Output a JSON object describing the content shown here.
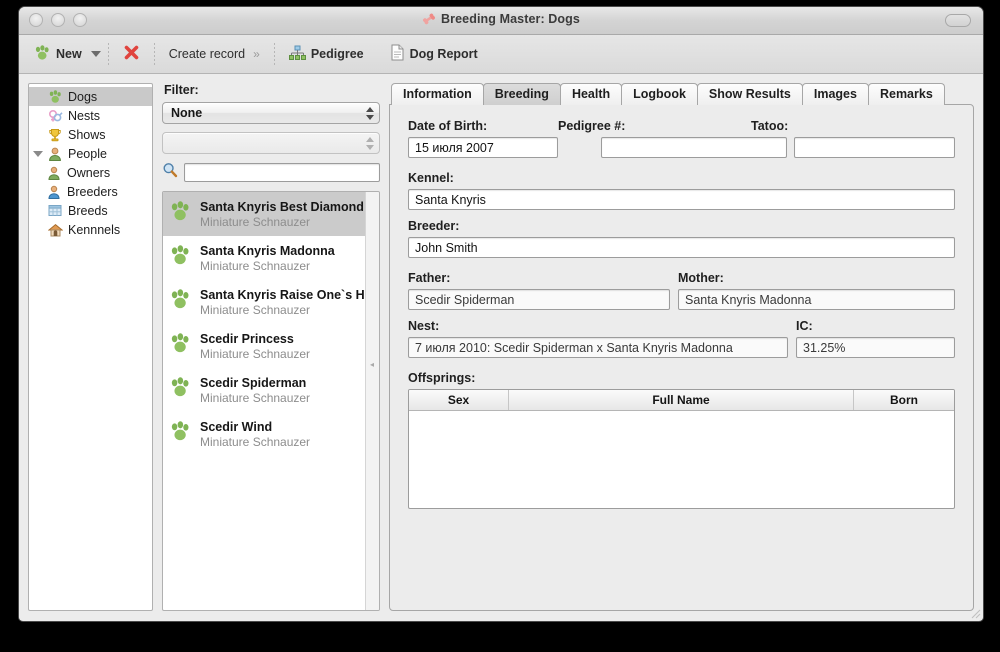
{
  "window": {
    "title": "Breeding Master: Dogs",
    "title_icon": "bone-icon",
    "controls": [
      "close-button",
      "minimize-button",
      "zoom-button"
    ],
    "toolbar_toggle": "toolbar-toggle-button"
  },
  "toolbar": {
    "items": [
      {
        "label": "New",
        "icon": "paw-icon",
        "has_dropdown": true
      },
      {
        "label": "",
        "icon": "delete-x-icon",
        "has_dropdown": false
      },
      {
        "label": "Create record",
        "icon": "",
        "has_dropdown": false,
        "suffix": "»"
      },
      {
        "label": "Pedigree",
        "icon": "pedigree-tree-icon",
        "has_dropdown": false
      },
      {
        "label": "Dog Report",
        "icon": "document-icon",
        "has_dropdown": false
      }
    ]
  },
  "sidebar": {
    "items": [
      {
        "label": "Dogs",
        "icon": "paw-icon",
        "selected": true,
        "indent": false,
        "twisty": ""
      },
      {
        "label": "Nests",
        "icon": "gender-symbols-icon",
        "selected": false,
        "indent": false,
        "twisty": ""
      },
      {
        "label": "Shows",
        "icon": "trophy-icon",
        "selected": false,
        "indent": false,
        "twisty": ""
      },
      {
        "label": "People",
        "icon": "person-icon",
        "selected": false,
        "indent": false,
        "twisty": "expanded"
      },
      {
        "label": "Owners",
        "icon": "person-green-icon",
        "selected": false,
        "indent": true,
        "twisty": ""
      },
      {
        "label": "Breeders",
        "icon": "person-blue-icon",
        "selected": false,
        "indent": true,
        "twisty": ""
      },
      {
        "label": "Breeds",
        "icon": "table-icon",
        "selected": false,
        "indent": false,
        "twisty": ""
      },
      {
        "label": "Kennnels",
        "icon": "house-icon",
        "selected": false,
        "indent": false,
        "twisty": ""
      }
    ]
  },
  "filter": {
    "label": "Filter:",
    "primary_value": "None",
    "secondary_value": "",
    "search_value": "",
    "search_icon": "magnifier-icon"
  },
  "dog_list": [
    {
      "name": "Santa Knyris Best Diamond",
      "breed": "Miniature Schnauzer",
      "selected": true
    },
    {
      "name": "Santa Knyris Madonna",
      "breed": "Miniature Schnauzer",
      "selected": false
    },
    {
      "name": "Santa Knyris Raise One`s Ho",
      "breed": "Miniature Schnauzer",
      "selected": false
    },
    {
      "name": "Scedir Princess",
      "breed": "Miniature Schnauzer",
      "selected": false
    },
    {
      "name": "Scedir Spiderman",
      "breed": "Miniature Schnauzer",
      "selected": false
    },
    {
      "name": "Scedir Wind",
      "breed": "Miniature Schnauzer",
      "selected": false
    }
  ],
  "tabs": [
    {
      "label": "Information",
      "active": false
    },
    {
      "label": "Breeding",
      "active": true
    },
    {
      "label": "Health",
      "active": false
    },
    {
      "label": "Logbook",
      "active": false
    },
    {
      "label": "Show Results",
      "active": false
    },
    {
      "label": "Images",
      "active": false
    },
    {
      "label": "Remarks",
      "active": false
    }
  ],
  "form": {
    "date_of_birth": {
      "label": "Date of Birth:",
      "value": "15 июля 2007"
    },
    "pedigree_no": {
      "label": "Pedigree #:",
      "value": ""
    },
    "tatoo": {
      "label": "Tatoo:",
      "value": ""
    },
    "kennel": {
      "label": "Kennel:",
      "value": "Santa Knyris"
    },
    "breeder": {
      "label": "Breeder:",
      "value": "John Smith"
    },
    "father": {
      "label": "Father:",
      "value": "Scedir Spiderman"
    },
    "mother": {
      "label": "Mother:",
      "value": "Santa Knyris Madonna"
    },
    "nest": {
      "label": "Nest:",
      "value": "7 июля 2010: Scedir Spiderman x Santa Knyris Madonna"
    },
    "ic": {
      "label": "IC:",
      "value": "31.25%"
    },
    "offsprings": {
      "label": "Offsprings:",
      "columns": [
        "Sex",
        "Full Name",
        "Born"
      ],
      "rows": []
    }
  },
  "colors": {
    "accent_green": "#7fb354",
    "delete_red": "#e0443e",
    "window_bg": "#ececec",
    "selection": "#cbcbcb"
  }
}
